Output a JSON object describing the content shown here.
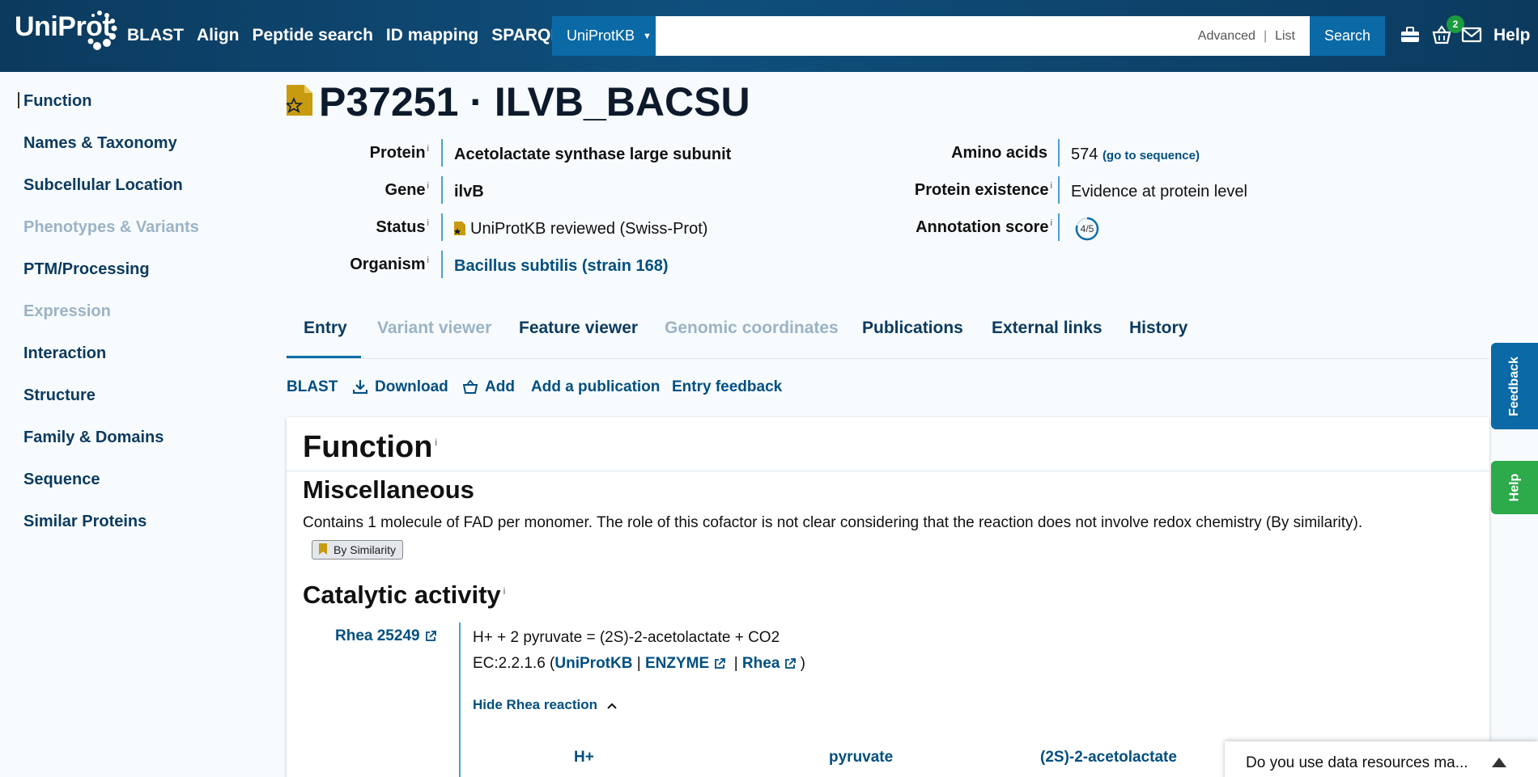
{
  "header": {
    "logo_text": "UniProt",
    "nav": [
      "BLAST",
      "Align",
      "Peptide search",
      "ID mapping",
      "SPARQL"
    ],
    "database_select": "UniProtKB",
    "search_value": "",
    "advanced_label": "Advanced",
    "list_label": "List",
    "search_button": "Search",
    "basket_count": "2",
    "help_label": "Help",
    "icons": [
      "tool-box-icon",
      "basket-icon",
      "mail-icon"
    ]
  },
  "sidebar": {
    "items": [
      {
        "label": "Function",
        "enabled": true
      },
      {
        "label": "Names & Taxonomy",
        "enabled": true
      },
      {
        "label": "Subcellular Location",
        "enabled": true
      },
      {
        "label": "Phenotypes & Variants",
        "enabled": false
      },
      {
        "label": "PTM/Processing",
        "enabled": true
      },
      {
        "label": "Expression",
        "enabled": false
      },
      {
        "label": "Interaction",
        "enabled": true
      },
      {
        "label": "Structure",
        "enabled": true
      },
      {
        "label": "Family & Domains",
        "enabled": true
      },
      {
        "label": "Sequence",
        "enabled": true
      },
      {
        "label": "Similar Proteins",
        "enabled": true
      }
    ]
  },
  "entry": {
    "title": "P37251 · ILVB_BACSU",
    "info_marker": "i",
    "protein_label": "Protein",
    "protein_value": "Acetolactate synthase large subunit",
    "gene_label": "Gene",
    "gene_value": "ilvB",
    "status_label": "Status",
    "status_value": "UniProtKB reviewed (Swiss-Prot)",
    "organism_label": "Organism",
    "organism_value": "Bacillus subtilis (strain 168)",
    "amino_acids_label": "Amino acids",
    "amino_acids_value": "574",
    "go_to_sequence": "(go to sequence)",
    "existence_label": "Protein existence",
    "existence_value": "Evidence at protein level",
    "annotation_label": "Annotation score",
    "annotation_value": "4/5"
  },
  "tabs": [
    {
      "label": "Entry",
      "enabled": true,
      "active": true
    },
    {
      "label": "Variant viewer",
      "enabled": false
    },
    {
      "label": "Feature viewer",
      "enabled": true
    },
    {
      "label": "Genomic coordinates",
      "enabled": false
    },
    {
      "label": "Publications",
      "enabled": true
    },
    {
      "label": "External links",
      "enabled": true
    },
    {
      "label": "History",
      "enabled": true
    }
  ],
  "toolbar": {
    "blast": "BLAST",
    "download": "Download",
    "add": "Add",
    "add_publication": "Add a publication",
    "feedback": "Entry feedback"
  },
  "function_section": {
    "title": "Function",
    "misc_title": "Miscellaneous",
    "misc_text": "Contains 1 molecule of FAD per monomer. The role of this cofactor is not clear considering that the reaction does not involve redox chemistry (By similarity).",
    "evidence_tag": "By Similarity",
    "catalytic_title": "Catalytic activity",
    "rhea_id": "Rhea 25249",
    "reaction": "H+ + 2 pyruvate = (2S)-2-acetolactate + CO2",
    "ec_prefix": "EC:2.2.1.6 (",
    "ec_uniprotkb": "UniProtKB",
    "ec_enzyme": "ENZYME",
    "ec_rhea": "Rhea",
    "ec_suffix": ")",
    "hide_rhea": "Hide Rhea reaction",
    "compounds": [
      "H+",
      "pyruvate",
      "(2S)-2-acetolactate"
    ]
  },
  "side_tabs": {
    "feedback": "Feedback",
    "help": "Help"
  },
  "survey": {
    "text": "Do you use data resources ma..."
  },
  "colors": {
    "header_bg": "#0f4f7c",
    "accent": "#0b6aa6",
    "link": "#014f80",
    "help_green": "#2daa4a",
    "reviewed_gold": "#c79a10"
  }
}
